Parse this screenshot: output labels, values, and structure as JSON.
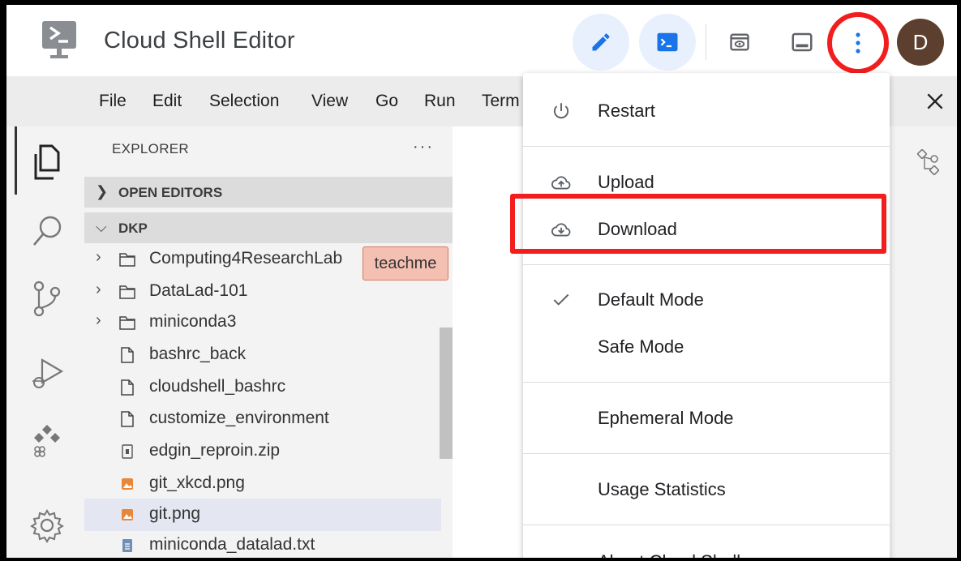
{
  "header": {
    "title": "Cloud Shell Editor",
    "avatar_initial": "D",
    "icons": [
      "terminal-logo-icon",
      "pencil-icon",
      "terminal-icon",
      "web-preview-icon",
      "panel-icon",
      "more-vert-icon"
    ]
  },
  "menubar": {
    "items": [
      "File",
      "Edit",
      "Selection",
      "View",
      "Go",
      "Run",
      "Term"
    ]
  },
  "explorer": {
    "title": "EXPLORER",
    "more": "···",
    "open_editors": "OPEN EDITORS",
    "workspace": "DKP",
    "tooltip": "teachme",
    "items": [
      {
        "name": "Computing4ResearchLab",
        "type": "folder"
      },
      {
        "name": "DataLad-101",
        "type": "folder"
      },
      {
        "name": "miniconda3",
        "type": "folder"
      },
      {
        "name": "bashrc_back",
        "type": "file"
      },
      {
        "name": "cloudshell_bashrc",
        "type": "file"
      },
      {
        "name": "customize_environment",
        "type": "file"
      },
      {
        "name": "edgin_reproin.zip",
        "type": "zip"
      },
      {
        "name": "git_xkcd.png",
        "type": "image"
      },
      {
        "name": "git.png",
        "type": "image",
        "selected": true
      },
      {
        "name": "miniconda_datalad.txt",
        "type": "text"
      }
    ]
  },
  "dropdown": {
    "restart": "Restart",
    "upload": "Upload",
    "download": "Download",
    "default_mode": "Default Mode",
    "safe_mode": "Safe Mode",
    "ephemeral_mode": "Ephemeral Mode",
    "usage_statistics": "Usage Statistics",
    "about": "About Cloud Shell"
  },
  "colors": {
    "accent_blue": "#1a73e8",
    "highlight_red": "#f21e1e",
    "avatar_brown": "#5d3f30"
  }
}
